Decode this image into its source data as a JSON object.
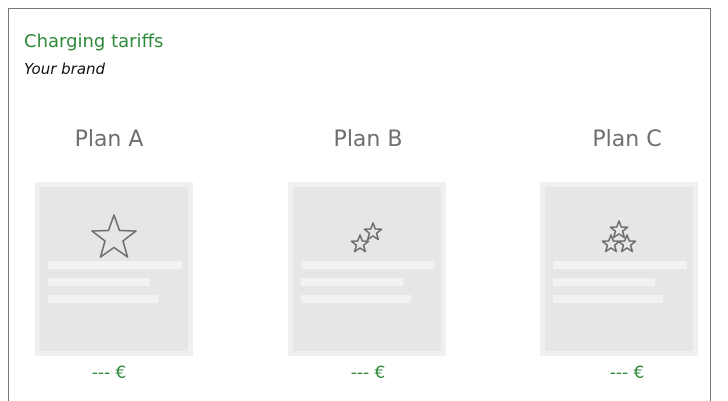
{
  "header": {
    "title": "Charging tariffs",
    "subtitle": "Your brand"
  },
  "plans": [
    {
      "name": "Plan A",
      "price": "--- €",
      "icon": "single-star-icon"
    },
    {
      "name": "Plan B",
      "price": "--- €",
      "icon": "two-stars-icon"
    },
    {
      "name": "Plan C",
      "price": "--- €",
      "icon": "three-stars-icon"
    }
  ],
  "colors": {
    "accent_green": "#2f8a3b",
    "card_bg": "#e6e6e6",
    "plan_name_gray": "#6f6f6f"
  }
}
